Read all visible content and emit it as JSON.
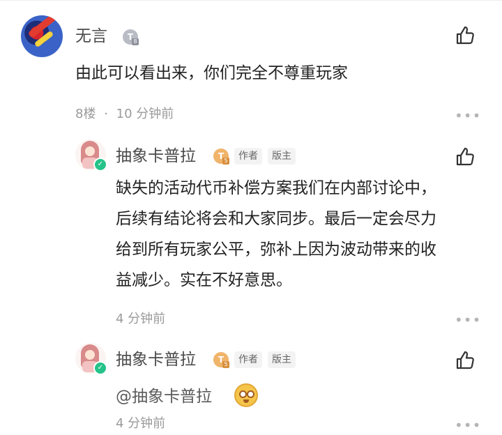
{
  "colors": {
    "verified": "#25c38a",
    "level_badge_main": "#b9bcc4",
    "level_badge_author": "#f0b46b"
  },
  "comment": {
    "username": "无言",
    "level_badge": "T",
    "level_sub": "8",
    "content": "由此可以看出来，你们完全不尊重玩家",
    "floor": "8楼",
    "separator": "·",
    "time": "10 分钟前",
    "more": "•••",
    "icons": {
      "avatar": "user-avatar",
      "like": "thumbs-up-icon",
      "more": "more-dots-icon"
    }
  },
  "replies": [
    {
      "username": "抽象卡普拉",
      "level_badge": "T",
      "level_sub": "5",
      "tags": [
        "作者",
        "版主"
      ],
      "content_lines": [
        "缺失的活动代币补偿方案我们在内部讨论中，",
        "后续有结论将会和大家同步。最后一定会尽力",
        "给到所有玩家公平，弥补上因为波动带来的收",
        "益减少。实在不好意思。"
      ],
      "time": "4 分钟前",
      "more": "•••"
    },
    {
      "username": "抽象卡普拉",
      "level_badge": "T",
      "level_sub": "5",
      "tags": [
        "作者",
        "版主"
      ],
      "mention": "@抽象卡普拉",
      "emoji": "shocked-face-emoji",
      "time": "4 分钟前",
      "more": "•••"
    }
  ]
}
